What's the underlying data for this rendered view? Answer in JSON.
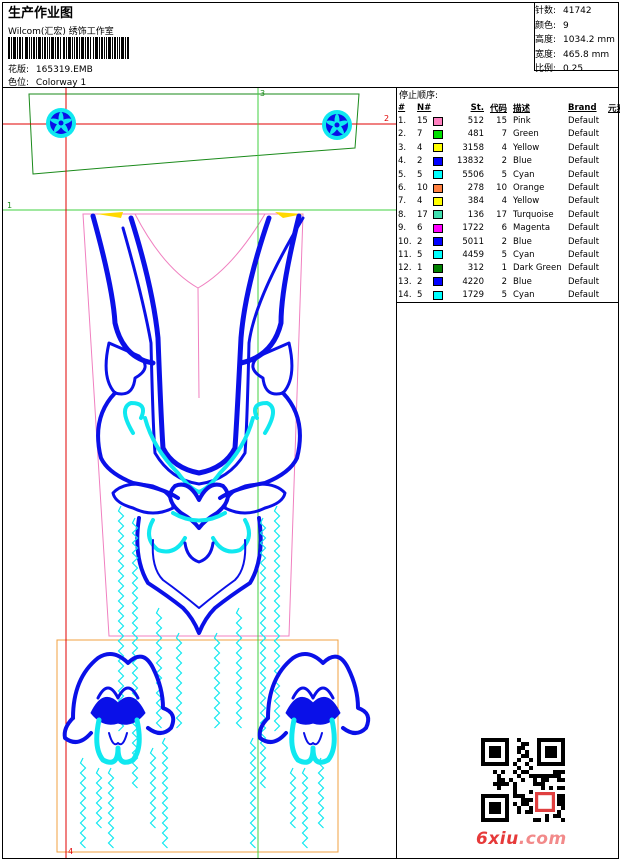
{
  "header": {
    "title": "生产作业图",
    "subtitle": "Wilcom(汇宏) 绣饰工作室",
    "pattern_label": "花版:",
    "pattern_value": "165319.EMB",
    "colorway_label": "色位:",
    "colorway_value": "Colorway 1"
  },
  "stats": [
    {
      "label": "针数:",
      "value": "41742"
    },
    {
      "label": "颜色:",
      "value": "9"
    },
    {
      "label": "高度:",
      "value": "1034.2 mm"
    },
    {
      "label": "宽度:",
      "value": "465.8 mm"
    },
    {
      "label": "比例:",
      "value": "0.25"
    }
  ],
  "stop_sequence": {
    "title": "停止顺序:",
    "headers": {
      "num": "#",
      "needle": "N#",
      "stitches": "St.",
      "code": "代码",
      "desc": "描述",
      "brand": "Brand",
      "elem": "元素"
    },
    "rows": [
      {
        "num": "1.",
        "needle": "15",
        "color": "#ff80c0",
        "stitches": "512",
        "code": "15",
        "desc": "Pink",
        "brand": "Default"
      },
      {
        "num": "2.",
        "needle": "7",
        "color": "#00e000",
        "stitches": "481",
        "code": "7",
        "desc": "Green",
        "brand": "Default"
      },
      {
        "num": "3.",
        "needle": "4",
        "color": "#ffff00",
        "stitches": "3158",
        "code": "4",
        "desc": "Yellow",
        "brand": "Default"
      },
      {
        "num": "4.",
        "needle": "2",
        "color": "#0000ff",
        "stitches": "13832",
        "code": "2",
        "desc": "Blue",
        "brand": "Default"
      },
      {
        "num": "5.",
        "needle": "5",
        "color": "#00ffff",
        "stitches": "5506",
        "code": "5",
        "desc": "Cyan",
        "brand": "Default"
      },
      {
        "num": "6.",
        "needle": "10",
        "color": "#ff8040",
        "stitches": "278",
        "code": "10",
        "desc": "Orange",
        "brand": "Default"
      },
      {
        "num": "7.",
        "needle": "4",
        "color": "#ffff00",
        "stitches": "384",
        "code": "4",
        "desc": "Yellow",
        "brand": "Default"
      },
      {
        "num": "8.",
        "needle": "17",
        "color": "#40e0b0",
        "stitches": "136",
        "code": "17",
        "desc": "Turquoise",
        "brand": "Default"
      },
      {
        "num": "9.",
        "needle": "6",
        "color": "#ff00ff",
        "stitches": "1722",
        "code": "6",
        "desc": "Magenta",
        "brand": "Default"
      },
      {
        "num": "10.",
        "needle": "2",
        "color": "#0000ff",
        "stitches": "5011",
        "code": "2",
        "desc": "Blue",
        "brand": "Default"
      },
      {
        "num": "11.",
        "needle": "5",
        "color": "#00ffff",
        "stitches": "4459",
        "code": "5",
        "desc": "Cyan",
        "brand": "Default"
      },
      {
        "num": "12.",
        "needle": "1",
        "color": "#008000",
        "stitches": "312",
        "code": "1",
        "desc": "Dark Green",
        "brand": "Default"
      },
      {
        "num": "13.",
        "needle": "2",
        "color": "#0000ff",
        "stitches": "4220",
        "code": "2",
        "desc": "Blue",
        "brand": "Default"
      },
      {
        "num": "14.",
        "needle": "5",
        "color": "#00ffff",
        "stitches": "1729",
        "code": "5",
        "desc": "Cyan",
        "brand": "Default"
      }
    ]
  },
  "guide_labels": {
    "h1": "1",
    "h2": "2",
    "v3": "3",
    "v4": "4"
  },
  "watermark": {
    "brand": "6xiu",
    "brand_suffix": ".com"
  },
  "design_colors": {
    "blue": "#0a10e8",
    "cyan": "#10e8f0",
    "green": "#1a8a1a",
    "red": "#e00000",
    "lime": "#40d040",
    "pink": "#f080c0",
    "orange": "#f0a040"
  }
}
